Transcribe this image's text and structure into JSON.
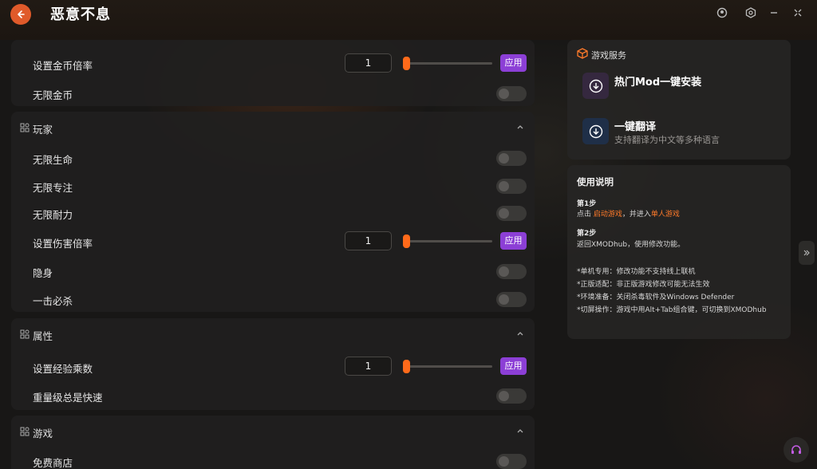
{
  "app": {
    "title": "恶意不息"
  },
  "sections": {
    "top": {
      "rows": [
        {
          "label": "设置金币倍率",
          "value": "1",
          "slider_fraction": 0.02,
          "apply": "应用"
        },
        {
          "label": "无限金币",
          "enabled": false
        }
      ]
    },
    "player": {
      "title": "玩家",
      "rows": [
        {
          "label": "无限生命",
          "enabled": false
        },
        {
          "label": "无限专注",
          "enabled": false
        },
        {
          "label": "无限耐力",
          "enabled": false
        },
        {
          "label": "设置伤害倍率",
          "value": "1",
          "slider_fraction": 0.02,
          "apply": "应用"
        },
        {
          "label": "隐身",
          "enabled": false
        },
        {
          "label": "一击必杀",
          "enabled": false
        }
      ]
    },
    "attributes": {
      "title": "属性",
      "rows": [
        {
          "label": "设置经验乘数",
          "value": "1",
          "slider_fraction": 0.02,
          "apply": "应用"
        },
        {
          "label": "重量级总是快速",
          "enabled": false
        }
      ]
    },
    "game": {
      "title": "游戏",
      "rows": [
        {
          "label": "免费商店",
          "enabled": false
        }
      ]
    }
  },
  "services": {
    "title": "游戏服务",
    "items": [
      {
        "name": "热门Mod一键安装",
        "desc": ""
      },
      {
        "name": "一键翻译",
        "desc": "支持翻译为中文等多种语言"
      }
    ]
  },
  "help": {
    "title": "使用说明",
    "step1": {
      "label": "第1步",
      "prefix": "点击 ",
      "link1": "启动游戏",
      "mid": "，并进入",
      "link2": "单人游戏"
    },
    "step2": {
      "label": "第2步",
      "text": "返回XMODhub，使用修改功能。"
    },
    "notes": [
      "*单机专用：修改功能不支持线上联机",
      "*正版适配：非正版游戏修改可能无法生效",
      "*环境准备：关闭杀毒软件及Windows Defender",
      "*切屏操作：游戏中用Alt+Tab组合键，可切换到XMODhub"
    ]
  },
  "colors": {
    "accent": "#ff6a1a",
    "apply": "#8c3fd6",
    "link": "#ff7a2a",
    "back": "#e05a2a"
  }
}
